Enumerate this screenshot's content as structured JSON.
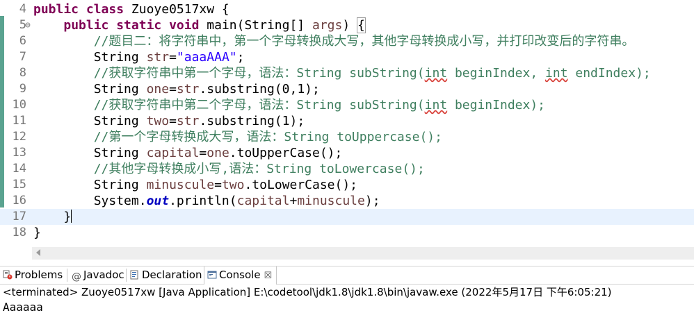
{
  "editor": {
    "lines": [
      {
        "num": "4",
        "tokens": [
          {
            "t": "kw",
            "v": "public class "
          },
          {
            "t": "plain",
            "v": "Zuoye0517xw {"
          }
        ]
      },
      {
        "num": "5",
        "fold": "⊖",
        "tokens": [
          {
            "t": "plain",
            "v": "    "
          },
          {
            "t": "kw",
            "v": "public static void "
          },
          {
            "t": "plain",
            "v": "main(String[] "
          },
          {
            "t": "var",
            "v": "args"
          },
          {
            "t": "plain",
            "v": ") "
          },
          {
            "t": "box",
            "v": "{"
          }
        ]
      },
      {
        "num": "6",
        "tokens": [
          {
            "t": "plain",
            "v": "        "
          },
          {
            "t": "cm",
            "v": "//题目二：将字符串中，第一个字母转换成大写，其他字母转换成小写，并打印改变后的字符串。"
          }
        ]
      },
      {
        "num": "7",
        "tokens": [
          {
            "t": "plain",
            "v": "        String "
          },
          {
            "t": "var",
            "v": "str"
          },
          {
            "t": "plain",
            "v": "="
          },
          {
            "t": "str",
            "v": "\"aaaAAA\""
          },
          {
            "t": "plain",
            "v": ";"
          }
        ]
      },
      {
        "num": "8",
        "tokens": [
          {
            "t": "plain",
            "v": "        "
          },
          {
            "t": "cm",
            "v": "//获取字符串中第一个字母，语法：String subString("
          },
          {
            "t": "cm-sq",
            "v": "int"
          },
          {
            "t": "cm",
            "v": " beginIndex, "
          },
          {
            "t": "cm-sq",
            "v": "int"
          },
          {
            "t": "cm",
            "v": " endIndex);"
          }
        ]
      },
      {
        "num": "9",
        "tokens": [
          {
            "t": "plain",
            "v": "        String "
          },
          {
            "t": "var",
            "v": "one"
          },
          {
            "t": "plain",
            "v": "="
          },
          {
            "t": "var",
            "v": "str"
          },
          {
            "t": "plain",
            "v": ".substring(0,1);"
          }
        ]
      },
      {
        "num": "10",
        "tokens": [
          {
            "t": "plain",
            "v": "        "
          },
          {
            "t": "cm",
            "v": "//获取字符串中第二个字母，语法：String subString("
          },
          {
            "t": "cm-sq",
            "v": "int"
          },
          {
            "t": "cm",
            "v": " beginIndex);"
          }
        ]
      },
      {
        "num": "11",
        "tokens": [
          {
            "t": "plain",
            "v": "        String "
          },
          {
            "t": "var",
            "v": "two"
          },
          {
            "t": "plain",
            "v": "="
          },
          {
            "t": "var",
            "v": "str"
          },
          {
            "t": "plain",
            "v": ".substring(1);"
          }
        ]
      },
      {
        "num": "12",
        "tokens": [
          {
            "t": "plain",
            "v": "        "
          },
          {
            "t": "cm",
            "v": "//第一个字母转换成大写，语法：String toUppercase();"
          }
        ]
      },
      {
        "num": "13",
        "tokens": [
          {
            "t": "plain",
            "v": "        String "
          },
          {
            "t": "var",
            "v": "capital"
          },
          {
            "t": "plain",
            "v": "="
          },
          {
            "t": "var",
            "v": "one"
          },
          {
            "t": "plain",
            "v": ".toUpperCase();"
          }
        ]
      },
      {
        "num": "14",
        "tokens": [
          {
            "t": "plain",
            "v": "        "
          },
          {
            "t": "cm",
            "v": "//其他字母转换成小写,语法：String toLowercase();"
          }
        ]
      },
      {
        "num": "15",
        "tokens": [
          {
            "t": "plain",
            "v": "        String "
          },
          {
            "t": "var",
            "v": "minuscule"
          },
          {
            "t": "plain",
            "v": "="
          },
          {
            "t": "var",
            "v": "two"
          },
          {
            "t": "plain",
            "v": ".toLowerCase();"
          }
        ]
      },
      {
        "num": "16",
        "tokens": [
          {
            "t": "plain",
            "v": "        System."
          },
          {
            "t": "static",
            "v": "out"
          },
          {
            "t": "plain",
            "v": ".println("
          },
          {
            "t": "var",
            "v": "capital"
          },
          {
            "t": "plain",
            "v": "+"
          },
          {
            "t": "var",
            "v": "minuscule"
          },
          {
            "t": "plain",
            "v": ");"
          }
        ]
      },
      {
        "num": "17",
        "current": true,
        "tokens": [
          {
            "t": "plain",
            "v": "    }"
          },
          {
            "t": "caret",
            "v": ""
          }
        ]
      },
      {
        "num": "18",
        "tokens": [
          {
            "t": "plain",
            "v": "}"
          }
        ]
      }
    ]
  },
  "tabs": {
    "problems": "Problems",
    "javadoc": "Javadoc",
    "declaration": "Declaration",
    "console": "Console",
    "console_close": "☒"
  },
  "console": {
    "status": "<terminated> Zuoye0517xw [Java Application] E:\\codetool\\jdk1.8\\jdk1.8\\bin\\javaw.exe (2022年5月17日 下午6:05:21)",
    "output": "Aaaaaa"
  },
  "colors": {
    "keyword": "#7f0055",
    "string": "#2a00ff",
    "comment": "#3f7f5f",
    "local_variable": "#6a3e3e",
    "static_field": "#0000c0",
    "current_line": "#e8f2fe",
    "change_bar": "#5aa390"
  }
}
